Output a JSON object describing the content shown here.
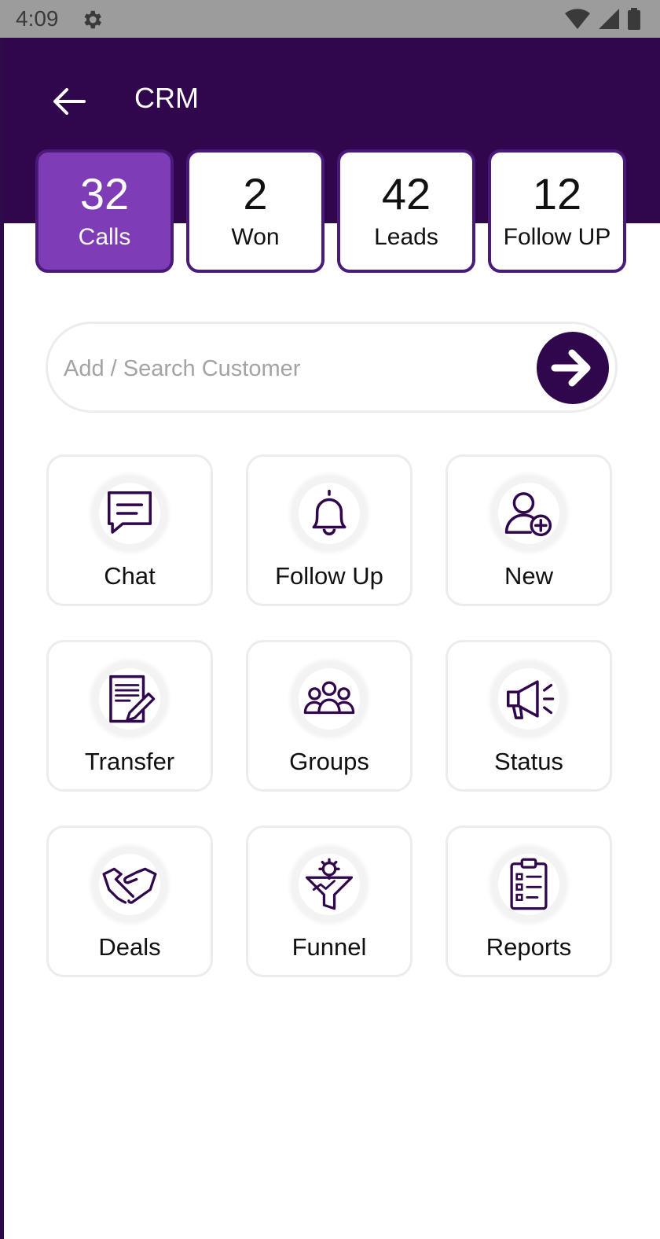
{
  "status_bar": {
    "time": "4:09"
  },
  "header": {
    "title": "CRM"
  },
  "stats": [
    {
      "value": "32",
      "label": "Calls",
      "active": true
    },
    {
      "value": "2",
      "label": "Won",
      "active": false
    },
    {
      "value": "42",
      "label": "Leads",
      "active": false
    },
    {
      "value": "12",
      "label": "Follow UP",
      "active": false
    }
  ],
  "search": {
    "placeholder": "Add / Search Customer",
    "value": ""
  },
  "tiles": [
    {
      "label": "Chat",
      "icon": "chat-icon"
    },
    {
      "label": "Follow Up",
      "icon": "bell-icon"
    },
    {
      "label": "New",
      "icon": "add-user-icon"
    },
    {
      "label": "Transfer",
      "icon": "document-edit-icon"
    },
    {
      "label": "Groups",
      "icon": "groups-icon"
    },
    {
      "label": "Status",
      "icon": "megaphone-icon"
    },
    {
      "label": "Deals",
      "icon": "handshake-icon"
    },
    {
      "label": "Funnel",
      "icon": "funnel-icon"
    },
    {
      "label": "Reports",
      "icon": "clipboard-list-icon"
    }
  ],
  "colors": {
    "header": "#30074d",
    "accent": "#7e3cb7",
    "icon": "#30074d"
  }
}
